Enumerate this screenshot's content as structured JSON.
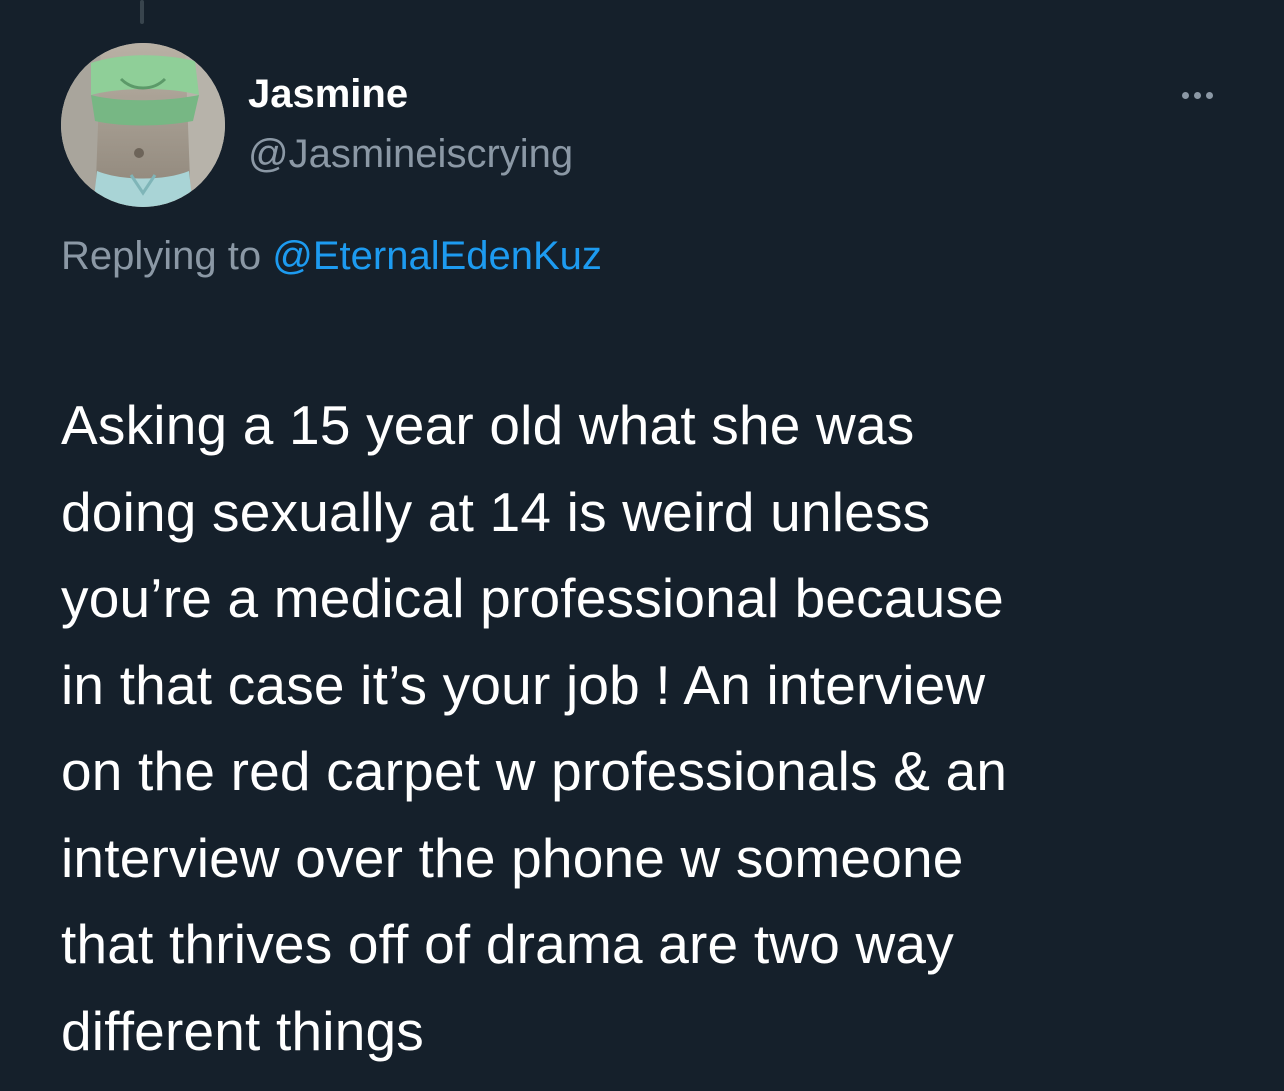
{
  "tweet": {
    "author": {
      "display_name": "Jasmine",
      "handle": "@Jasmineiscrying",
      "avatar_icon": "profile-photo-avatar"
    },
    "more_icon": "more-options-icon",
    "reply_context": {
      "prefix": "Replying to ",
      "mention": "@EternalEdenKuz"
    },
    "text_lines": [
      "Asking a 15 year old what she was",
      "doing sexually at 14 is weird unless",
      "you’re a medical professional because",
      "in that case it’s your job ! An interview",
      "on the red carpet w professionals & an",
      "interview over the phone w someone",
      "that thrives off of drama are two way",
      "different things"
    ]
  },
  "colors": {
    "background": "#15202b",
    "primary_text": "#ffffff",
    "secondary_text": "#8b98a5",
    "accent_link": "#1d9bf0",
    "thread_line": "#38444d"
  }
}
